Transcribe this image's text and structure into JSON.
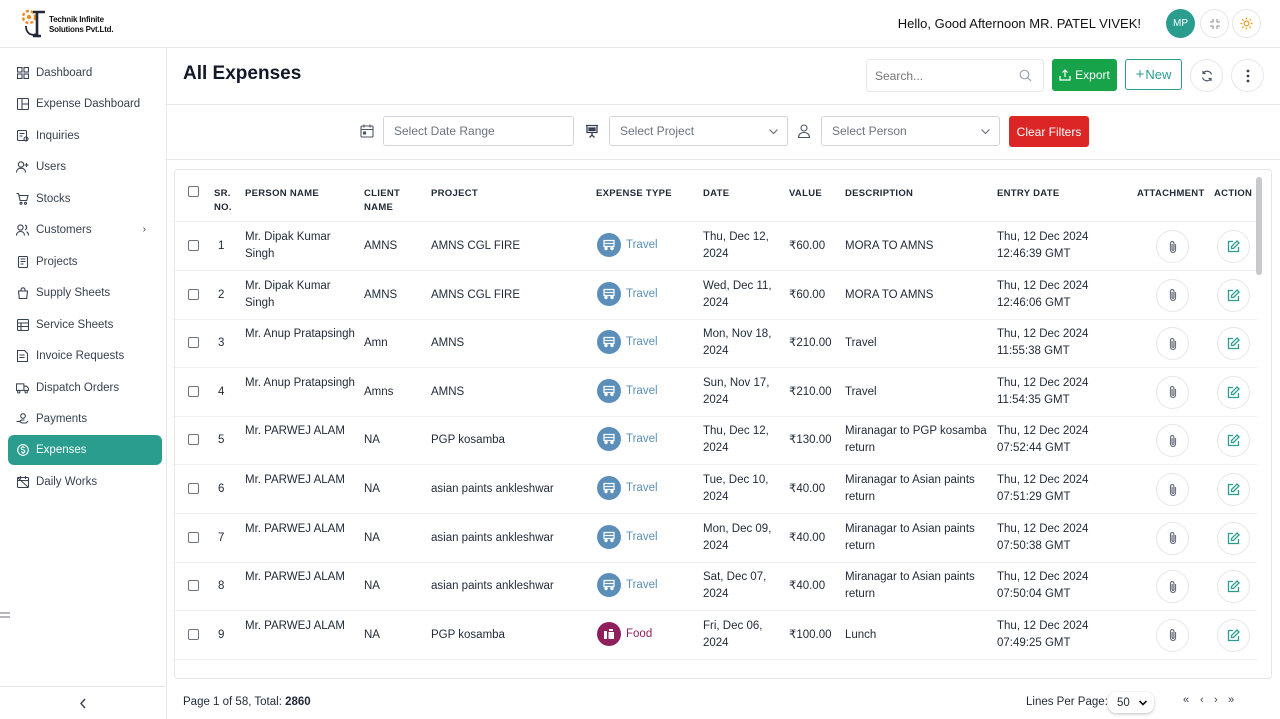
{
  "brand": {
    "line1": "Technik Infinite",
    "line2": "Solutions Pvt.Ltd."
  },
  "header": {
    "greeting": "Hello, Good Afternoon MR. PATEL VIVEK!",
    "avatar_initials": "MP"
  },
  "sidebar": {
    "items": [
      {
        "label": "Dashboard",
        "icon": "grid-icon"
      },
      {
        "label": "Expense Dashboard",
        "icon": "layout-icon"
      },
      {
        "label": "Inquiries",
        "icon": "inquiry-icon"
      },
      {
        "label": "Users",
        "icon": "user-plus-icon"
      },
      {
        "label": "Stocks",
        "icon": "cart-icon"
      },
      {
        "label": "Customers",
        "icon": "users-icon"
      },
      {
        "label": "Projects",
        "icon": "projects-icon"
      },
      {
        "label": "Supply Sheets",
        "icon": "bag-icon"
      },
      {
        "label": "Service Sheets",
        "icon": "sheet-icon"
      },
      {
        "label": "Invoice Requests",
        "icon": "invoice-icon"
      },
      {
        "label": "Dispatch Orders",
        "icon": "truck-icon"
      },
      {
        "label": "Payments",
        "icon": "hand-coin-icon"
      },
      {
        "label": "Expenses",
        "icon": "coin-icon"
      },
      {
        "label": "Daily Works",
        "icon": "calendar-off-icon"
      }
    ],
    "active_index": 12
  },
  "page": {
    "title": "All Expenses"
  },
  "toolbar": {
    "search_placeholder": "Search...",
    "export_label": "Export",
    "new_label": "New"
  },
  "filters": {
    "date_placeholder": "Select Date Range",
    "project_placeholder": "Select Project",
    "person_placeholder": "Select Person",
    "clear_label": "Clear Filters"
  },
  "table": {
    "headers": {
      "sr_line1": "SR.",
      "sr_line2": "NO.",
      "person": "PERSON NAME",
      "client_line1": "CLIENT",
      "client_line2": "NAME",
      "project": "PROJECT",
      "expense_type": "EXPENSE TYPE",
      "date": "DATE",
      "value": "VALUE",
      "description": "DESCRIPTION",
      "entry_date": "ENTRY DATE",
      "attachment": "ATTACHMENT",
      "action": "ACTION"
    },
    "rows": [
      {
        "sr": "1",
        "person_l1": "Mr. Dipak Kumar",
        "person_l2": "Singh",
        "client": "AMNS",
        "project": "AMNS CGL FIRE",
        "type": "Travel",
        "date_l1": "Thu, Dec 12,",
        "date_l2": "2024",
        "value": "₹60.00",
        "desc_l1": "MORA TO AMNS",
        "desc_l2": "",
        "entry_l1": "Thu, 12 Dec 2024",
        "entry_l2": "12:46:39 GMT"
      },
      {
        "sr": "2",
        "person_l1": "Mr. Dipak Kumar",
        "person_l2": "Singh",
        "client": "AMNS",
        "project": "AMNS CGL FIRE",
        "type": "Travel",
        "date_l1": "Wed, Dec 11,",
        "date_l2": "2024",
        "value": "₹60.00",
        "desc_l1": "MORA TO AMNS",
        "desc_l2": "",
        "entry_l1": "Thu, 12 Dec 2024",
        "entry_l2": "12:46:06 GMT"
      },
      {
        "sr": "3",
        "person_l1": "Mr. Anup Pratapsingh",
        "person_l2": "",
        "client": "Amn",
        "project": "AMNS",
        "type": "Travel",
        "date_l1": "Mon, Nov 18,",
        "date_l2": "2024",
        "value": "₹210.00",
        "desc_l1": "Travel",
        "desc_l2": "",
        "entry_l1": "Thu, 12 Dec 2024",
        "entry_l2": "11:55:38 GMT"
      },
      {
        "sr": "4",
        "person_l1": "Mr. Anup Pratapsingh",
        "person_l2": "",
        "client": "Amns",
        "project": "AMNS",
        "type": "Travel",
        "date_l1": "Sun, Nov 17,",
        "date_l2": "2024",
        "value": "₹210.00",
        "desc_l1": "Travel",
        "desc_l2": "",
        "entry_l1": "Thu, 12 Dec 2024",
        "entry_l2": "11:54:35 GMT"
      },
      {
        "sr": "5",
        "person_l1": "Mr. PARWEJ ALAM",
        "person_l2": "",
        "client": "NA",
        "project": "PGP kosamba",
        "type": "Travel",
        "date_l1": "Thu, Dec 12,",
        "date_l2": "2024",
        "value": "₹130.00",
        "desc_l1": "Miranagar to PGP kosamba",
        "desc_l2": "return",
        "entry_l1": "Thu, 12 Dec 2024",
        "entry_l2": "07:52:44 GMT"
      },
      {
        "sr": "6",
        "person_l1": "Mr. PARWEJ ALAM",
        "person_l2": "",
        "client": "NA",
        "project": "asian paints ankleshwar",
        "type": "Travel",
        "date_l1": "Tue, Dec 10,",
        "date_l2": "2024",
        "value": "₹40.00",
        "desc_l1": "Miranagar to Asian paints",
        "desc_l2": "return",
        "entry_l1": "Thu, 12 Dec 2024",
        "entry_l2": "07:51:29 GMT"
      },
      {
        "sr": "7",
        "person_l1": "Mr. PARWEJ ALAM",
        "person_l2": "",
        "client": "NA",
        "project": "asian paints ankleshwar",
        "type": "Travel",
        "date_l1": "Mon, Dec 09,",
        "date_l2": "2024",
        "value": "₹40.00",
        "desc_l1": "Miranagar to Asian paints",
        "desc_l2": "return",
        "entry_l1": "Thu, 12 Dec 2024",
        "entry_l2": "07:50:38 GMT"
      },
      {
        "sr": "8",
        "person_l1": "Mr. PARWEJ ALAM",
        "person_l2": "",
        "client": "NA",
        "project": "asian paints ankleshwar",
        "type": "Travel",
        "date_l1": "Sat, Dec 07,",
        "date_l2": "2024",
        "value": "₹40.00",
        "desc_l1": "Miranagar to Asian paints",
        "desc_l2": "return",
        "entry_l1": "Thu, 12 Dec 2024",
        "entry_l2": "07:50:04 GMT"
      },
      {
        "sr": "9",
        "person_l1": "Mr. PARWEJ ALAM",
        "person_l2": "",
        "client": "NA",
        "project": "PGP kosamba",
        "type": "Food",
        "date_l1": "Fri, Dec 06,",
        "date_l2": "2024",
        "value": "₹100.00",
        "desc_l1": "Lunch",
        "desc_l2": "",
        "entry_l1": "Thu, 12 Dec 2024",
        "entry_l2": "07:49:25 GMT"
      }
    ]
  },
  "footer": {
    "page_prefix": "Page 1 of 58, Total: ",
    "total": "2860",
    "lines_per_page_label": "Lines Per Page:",
    "lines_per_page_value": "50"
  },
  "colors": {
    "accent": "#2a9d8f",
    "travel": "#5b8fb9",
    "food": "#8e1f5c",
    "export": "#16a34a",
    "clear": "#dc2626"
  }
}
